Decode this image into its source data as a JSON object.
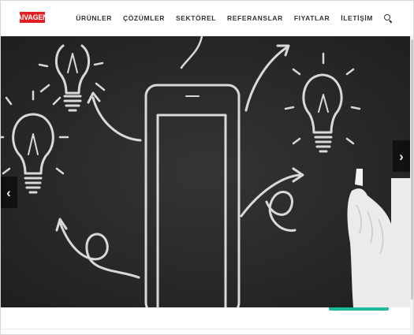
{
  "logo": {
    "text": "AIVAGEN",
    "color": "#e31e24"
  },
  "nav": {
    "items": [
      {
        "label": "ÜRÜNLER"
      },
      {
        "label": "ÇÖZÜMLER"
      },
      {
        "label": "SEKTÖREL"
      },
      {
        "label": "REFERANSLAR"
      },
      {
        "label": "FIYATLAR"
      },
      {
        "label": "İLETİŞİM"
      }
    ],
    "search_icon": "search-icon"
  },
  "hero": {
    "image": "chalkboard-lightbulbs-tablet-hand",
    "background": "#2a2b2b",
    "prev_icon": "chevron-left-icon",
    "prev_glyph": "‹",
    "next_icon": "chevron-right-icon",
    "next_glyph": "›"
  },
  "colors": {
    "accent": "#1bbc9b",
    "brand": "#e31e24"
  }
}
